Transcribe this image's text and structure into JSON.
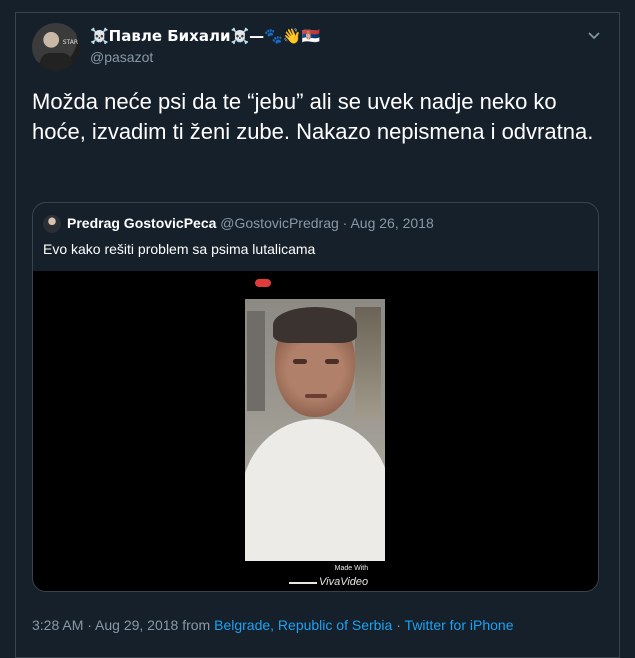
{
  "author": {
    "display_name": "☠️Павле Бихали☠️—🐾👋🇷🇸",
    "handle": "@pasazot",
    "avatar_caption": "STAR"
  },
  "tweet": {
    "text": "Možda neće psi da te “jebu” ali se uvek nadje neko ko hoće, izvadim ti ženi zube. Nakazo nepismena i odvratna."
  },
  "quoted": {
    "name": "Predrag GostovicPeca",
    "meta": "@GostovicPredrag · Aug 26, 2018",
    "text": "Evo kako rešiti problem sa psima lutalicama",
    "watermark_made": "Made With",
    "watermark_brand": "VivaVideo"
  },
  "footer": {
    "time": "3:28 AM · Aug 29, 2018 from ",
    "location": "Belgrade, Republic of Serbia",
    "separator": " · ",
    "source": "Twitter for iPhone"
  },
  "colors": {
    "background": "#15202b",
    "border": "#38444d",
    "muted": "#8899a6",
    "link": "#1da1f2"
  },
  "icons": [
    "chevron-down-icon"
  ]
}
